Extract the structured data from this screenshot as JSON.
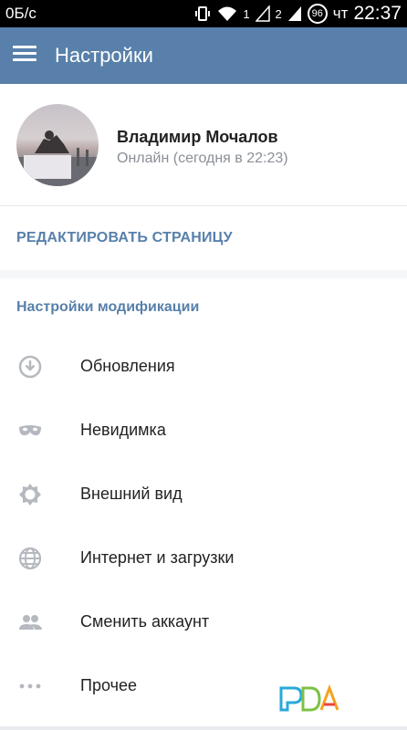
{
  "status_bar": {
    "carrier_speed": "0Б/с",
    "sim1": "1",
    "sim2": "2",
    "battery": "96",
    "day": "чт",
    "time": "22:37"
  },
  "app_bar": {
    "title": "Настройки"
  },
  "profile": {
    "name": "Владимир Мочалов",
    "status": "Онлайн (сегодня в 22:23)"
  },
  "edit_page": {
    "label": "РЕДАКТИРОВАТЬ СТРАНИЦУ"
  },
  "mod_settings": {
    "title": "Настройки модификации",
    "items": [
      {
        "label": "Обновления",
        "icon": "download-circle-icon"
      },
      {
        "label": "Невидимка",
        "icon": "mask-icon"
      },
      {
        "label": "Внешний вид",
        "icon": "gear-icon"
      },
      {
        "label": "Интернет и загрузки",
        "icon": "globe-icon"
      },
      {
        "label": "Сменить аккаунт",
        "icon": "people-icon"
      },
      {
        "label": "Прочее",
        "icon": "more-dots-icon"
      }
    ]
  },
  "colors": {
    "accent": "#5880aa",
    "icon_gray": "#b5b9bf"
  }
}
